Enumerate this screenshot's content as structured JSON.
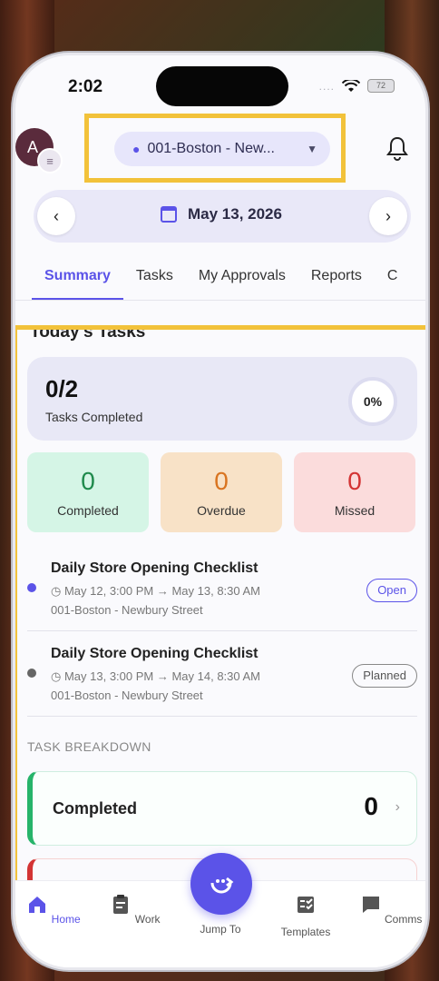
{
  "status_bar": {
    "time": "2:02",
    "signal": "....",
    "battery": "72"
  },
  "header": {
    "avatar_initial": "A",
    "location": "001-Boston - New...",
    "date": "May 13, 2026",
    "prev_label": "‹",
    "next_label": "›"
  },
  "tabs": [
    {
      "label": "Summary",
      "active": true
    },
    {
      "label": "Tasks",
      "active": false
    },
    {
      "label": "My Approvals",
      "active": false
    },
    {
      "label": "Reports",
      "active": false
    },
    {
      "label": "C",
      "active": false
    }
  ],
  "section_title": "Today's Tasks",
  "summary": {
    "value": "0/2",
    "label": "Tasks Completed",
    "percent": "0%"
  },
  "stats": {
    "completed": {
      "value": "0",
      "label": "Completed"
    },
    "overdue": {
      "value": "0",
      "label": "Overdue"
    },
    "missed": {
      "value": "0",
      "label": "Missed"
    }
  },
  "tasks": [
    {
      "title": "Daily Store Opening Checklist",
      "time": "May 12, 3:00 PM → May 13, 8:30 AM",
      "location": "001-Boston - Newbury Street",
      "status": "Open",
      "dot_color": "#5b53e8"
    },
    {
      "title": "Daily Store Opening Checklist",
      "time": "May 13, 3:00 PM → May 14, 8:30 AM",
      "location": "001-Boston - Newbury Street",
      "status": "Planned",
      "dot_color": "#666666"
    }
  ],
  "breakdown": {
    "title": "TASK BREAKDOWN",
    "items": [
      {
        "label": "Completed",
        "count": "0"
      }
    ]
  },
  "bottom_nav": [
    {
      "label": "Home",
      "icon": "home-icon"
    },
    {
      "label": "Work",
      "icon": "clipboard-icon"
    },
    {
      "label": "Jump To",
      "icon": "jump-icon"
    },
    {
      "label": "Templates",
      "icon": "templates-icon"
    },
    {
      "label": "Comms",
      "icon": "chat-icon"
    }
  ],
  "colors": {
    "accent": "#5b53e8",
    "highlight": "#f2c23a",
    "success": "#27b46a",
    "warning": "#d97420",
    "danger": "#d33434"
  }
}
